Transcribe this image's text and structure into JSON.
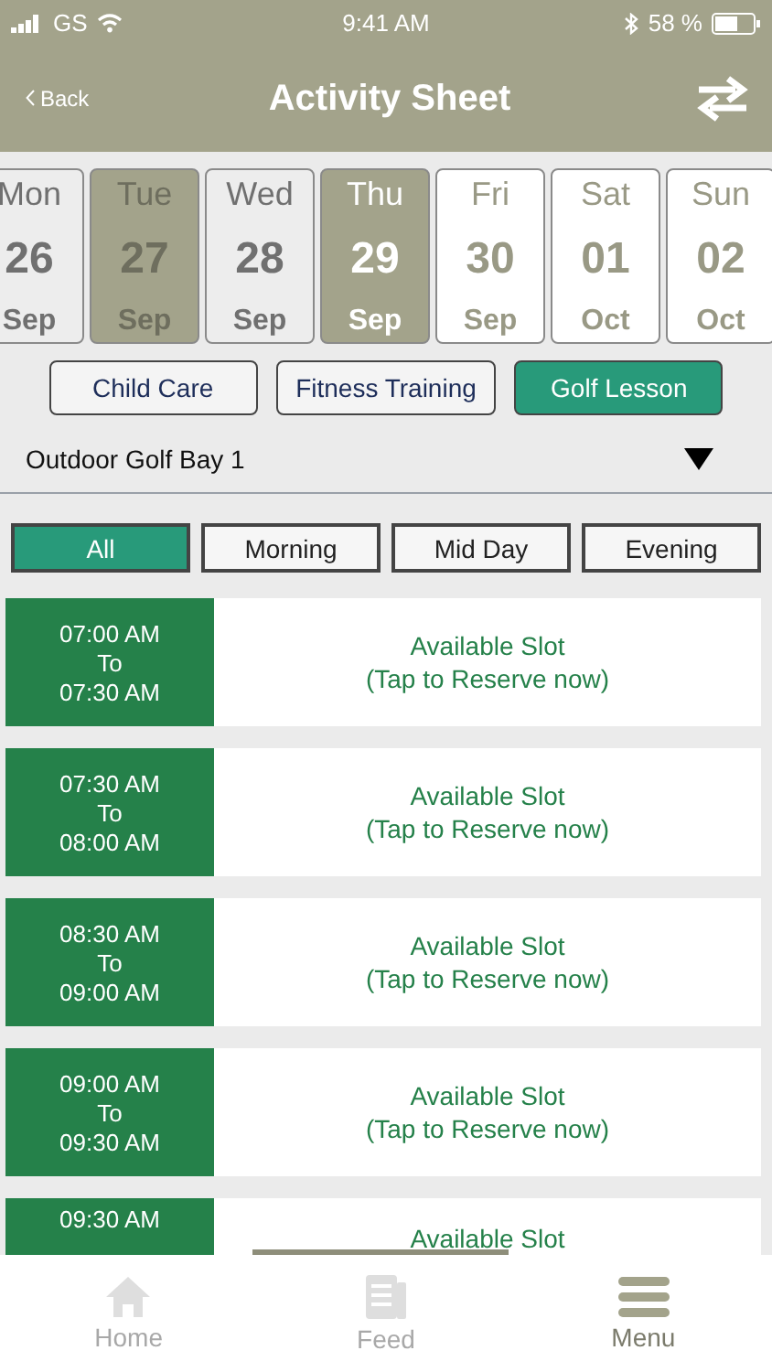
{
  "status_bar": {
    "carrier": "GS",
    "time": "9:41 AM",
    "battery": "58 %"
  },
  "header": {
    "back": "Back",
    "title": "Activity Sheet"
  },
  "days": [
    {
      "weekday": "Mon",
      "day": "26",
      "month": "Sep",
      "kind": "past",
      "selected": false
    },
    {
      "weekday": "Tue",
      "day": "27",
      "month": "Sep",
      "kind": "closed",
      "selected": false
    },
    {
      "weekday": "Wed",
      "day": "28",
      "month": "Sep",
      "kind": "past",
      "selected": false
    },
    {
      "weekday": "Thu",
      "day": "29",
      "month": "Sep",
      "kind": "open",
      "selected": true
    },
    {
      "weekday": "Fri",
      "day": "30",
      "month": "Sep",
      "kind": "open",
      "selected": false
    },
    {
      "weekday": "Sat",
      "day": "01",
      "month": "Oct",
      "kind": "open",
      "selected": false
    },
    {
      "weekday": "Sun",
      "day": "02",
      "month": "Oct",
      "kind": "open",
      "selected": false
    }
  ],
  "categories": [
    {
      "label": "Child Care",
      "selected": false
    },
    {
      "label": "Fitness Training",
      "selected": false
    },
    {
      "label": "Golf Lesson",
      "selected": true
    }
  ],
  "location": {
    "value": "Outdoor Golf Bay 1"
  },
  "filters": [
    {
      "label": "All",
      "selected": true
    },
    {
      "label": "Morning",
      "selected": false
    },
    {
      "label": "Mid Day",
      "selected": false
    },
    {
      "label": "Evening",
      "selected": false
    }
  ],
  "slots": [
    {
      "from": "07:00 AM",
      "to_word": "To",
      "to": "07:30 AM",
      "status": "Available Slot",
      "hint": "(Tap to Reserve now)"
    },
    {
      "from": "07:30 AM",
      "to_word": "To",
      "to": "08:00 AM",
      "status": "Available Slot",
      "hint": "(Tap to Reserve now)"
    },
    {
      "from": "08:30 AM",
      "to_word": "To",
      "to": "09:00 AM",
      "status": "Available Slot",
      "hint": "(Tap to Reserve now)"
    },
    {
      "from": "09:00 AM",
      "to_word": "To",
      "to": "09:30 AM",
      "status": "Available Slot",
      "hint": "(Tap to Reserve now)"
    },
    {
      "from": "09:30 AM",
      "status": "Available Slot"
    }
  ],
  "tab_bar": [
    {
      "label": "Home",
      "selected": false
    },
    {
      "label": "Feed",
      "selected": false
    },
    {
      "label": "Menu",
      "selected": true
    }
  ]
}
